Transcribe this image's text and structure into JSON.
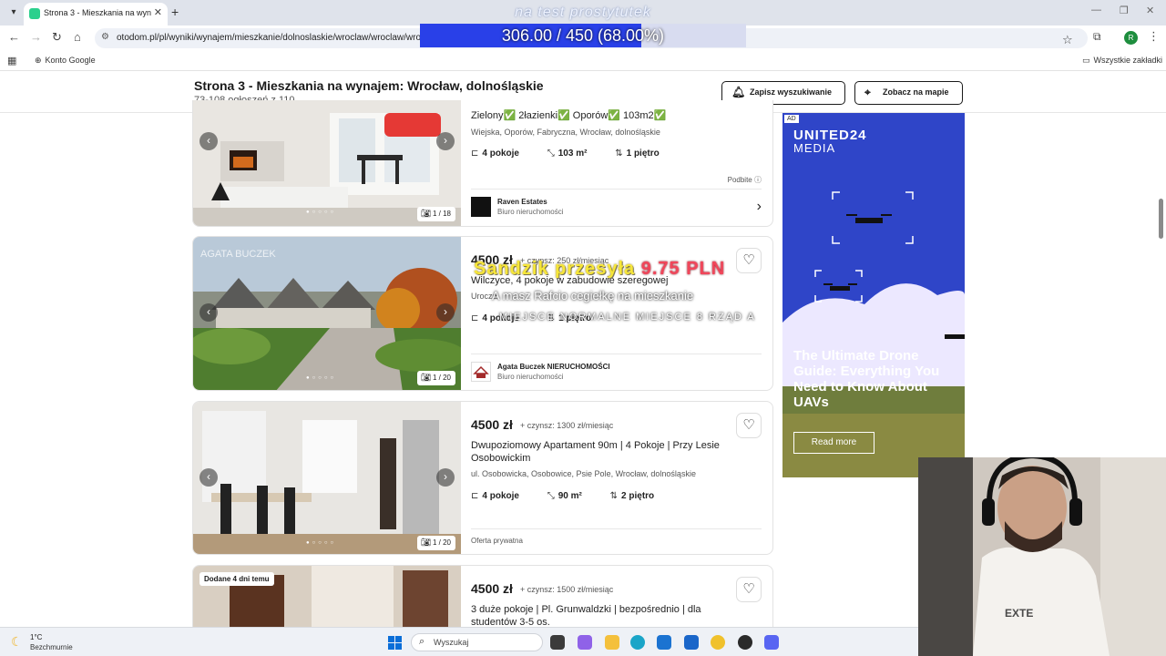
{
  "browser": {
    "tab_title": "Strona 3 - Mieszkania na wynaj",
    "url": "otodom.pl/pl/wyniki/wynajem/mieszkanie/dolnoslaskie/wroclaw/wroclaw/wrocla",
    "bookmark_item": "Konto Google",
    "bookmark_all": "Wszystkie zakładki",
    "profile_initial": "R"
  },
  "overlay": {
    "top_text": "na test prostytutek",
    "goal_text": "306.00 / 450 (68.00%)",
    "goal_fraction": 0.68,
    "donation_name": "Sandzik przesyła",
    "donation_amount": "9.75 PLN",
    "donation_message": "A masz Rafcio cegiełkę na mieszkanie",
    "donation_line3": "MIEJSCE NORMALNE MIEJSCE 8 RZĄD A"
  },
  "header": {
    "title": "Strona 3 - Mieszkania na wynajem: Wrocław, dolnośląskie",
    "subtitle": "73-108 ogłoszeń z 110",
    "save_search": "Zapisz wyszukiwanie",
    "show_map": "Zobacz na mapie"
  },
  "listings": [
    {
      "title": "Zielony✅ 2łazienki✅ Oporów✅ 103m2✅",
      "address": "Wiejska, Oporów, Fabryczna, Wrocław, dolnośląskie",
      "rooms": "4 pokoje",
      "area": "103 m²",
      "floor": "1 piętro",
      "boost_label": "Podbite",
      "agency": "Raven Estates",
      "agency_type": "Biuro nieruchomości",
      "photo_count": "1 / 18"
    },
    {
      "price": "4500 zł",
      "rent": "+ czynsz: 250 zł/miesiąc",
      "title": "Wilczyce, 4 pokoje w zabudowie szeregowej",
      "address": "Urocza",
      "rooms": "4 pokoje",
      "floor": "1 piętro",
      "agency": "Agata Buczek NIERUCHOMOŚCI",
      "agency_type": "Biuro nieruchomości",
      "photo_count": "1 / 20",
      "watermark": "AGATA BUCZEK NIERUCHOMOŚCI"
    },
    {
      "price": "4500 zł",
      "rent": "+ czynsz: 1300 zł/miesiąc",
      "title": "Dwupoziomowy Apartament 90m | 4 Pokoje | Przy Lesie Osobowickim",
      "address": "ul. Osobowicka, Osobowice, Psie Pole, Wrocław, dolnośląskie",
      "rooms": "4 pokoje",
      "area": "90 m²",
      "floor": "2 piętro",
      "owner": "Oferta prywatna",
      "photo_count": "1 / 20"
    },
    {
      "badge": "Dodane 4 dni temu",
      "price": "4500 zł",
      "rent": "+ czynsz: 1500 zł/miesiąc",
      "title": "3 duże pokoje | Pl. Grunwaldzki | bezpośrednio | dla studentów 3-5 os."
    }
  ],
  "ad": {
    "tag": "AD",
    "brand_line1": "UNITED24",
    "brand_line2": "MEDIA",
    "headline": "The Ultimate Drone Guide: Everything You Need to Know About UAVs",
    "cta": "Read more"
  },
  "taskbar": {
    "temperature": "1°C",
    "weather": "Bezchmurnie",
    "search_placeholder": "Wyszukaj"
  },
  "colors": {
    "goal_bar": "#2940e8",
    "ad_background": "#283cb8",
    "donation_name": "#f6e63a",
    "donation_amount": "#f1465a"
  }
}
